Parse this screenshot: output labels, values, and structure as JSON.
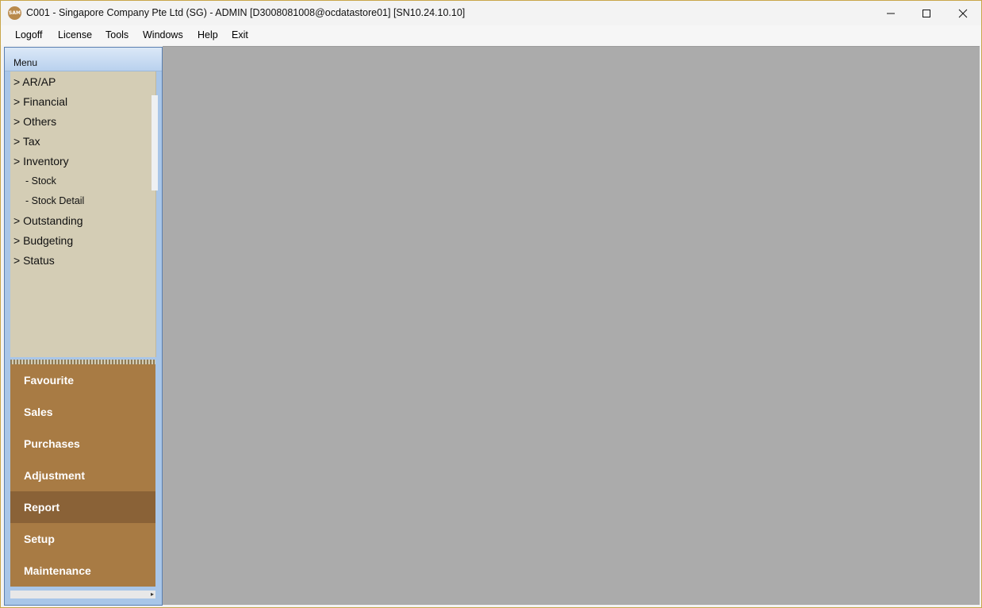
{
  "window": {
    "title": "C001 - Singapore Company Pte Ltd (SG) - ADMIN [D3008081008@ocdatastore01] [SN10.24.10.10]",
    "app_icon_text": "SAM",
    "controls": [
      "minimize-icon",
      "maximize-icon",
      "close-icon"
    ]
  },
  "menubar": {
    "items": [
      {
        "label": "Logoff"
      },
      {
        "label": "License"
      },
      {
        "label": "Tools"
      },
      {
        "label": "Windows"
      },
      {
        "label": "Help"
      },
      {
        "label": "Exit"
      }
    ]
  },
  "sidebar": {
    "header": "Menu",
    "tree": [
      {
        "label": "> AR/AP"
      },
      {
        "label": "> Financial"
      },
      {
        "label": "> Others"
      },
      {
        "label": "> Tax"
      },
      {
        "label": "> Inventory"
      },
      {
        "label": "- Stock"
      },
      {
        "label": "- Stock Detail"
      },
      {
        "label": "> Outstanding"
      },
      {
        "label": "> Budgeting"
      },
      {
        "label": "> Status"
      }
    ],
    "nav": [
      {
        "label": "Favourite"
      },
      {
        "label": "Sales"
      },
      {
        "label": "Purchases"
      },
      {
        "label": "Adjustment"
      },
      {
        "label": "Report",
        "active": true
      },
      {
        "label": "Setup"
      },
      {
        "label": "Maintenance"
      }
    ],
    "scroll_arrow": "▸"
  },
  "colors": {
    "nav_bg": "#a87b44",
    "nav_active": "#8a6237",
    "tree_bg": "#d4cdb5",
    "workspace_bg": "#ababab"
  }
}
